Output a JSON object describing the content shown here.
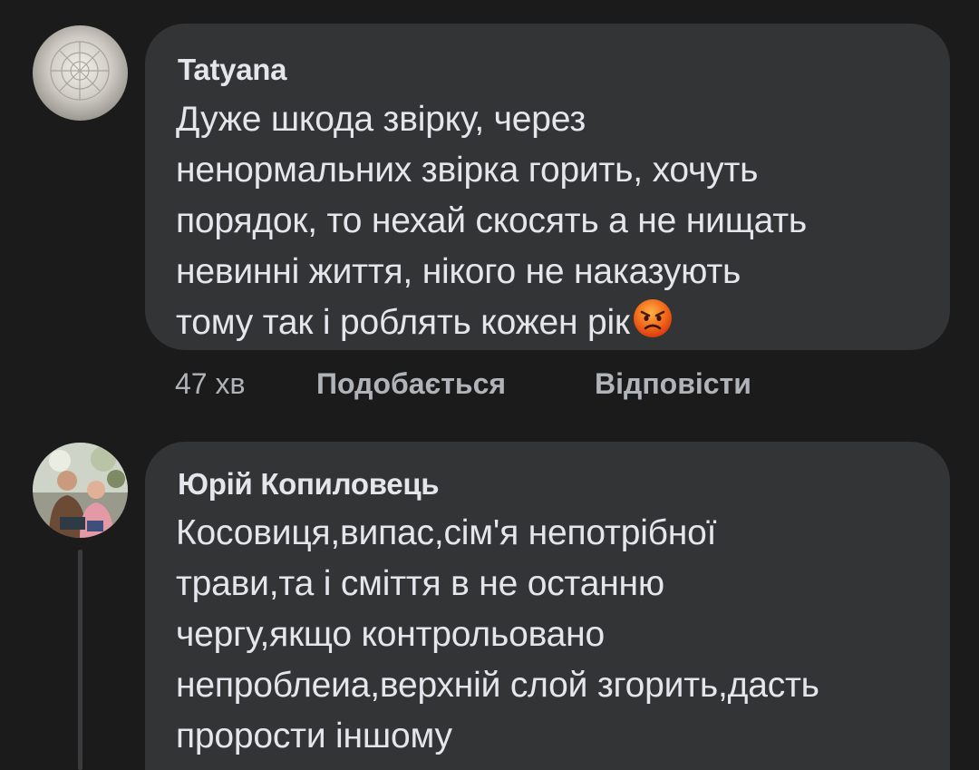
{
  "comments": [
    {
      "author": "Tatyana",
      "text_lines": [
        "Дуже шкода звірку, через",
        "ненормальних звірка горить, хочуть",
        "порядок, то нехай скосять а не нищать",
        "невинні життя, нікого не наказують",
        "тому так і роблять кожен рік"
      ],
      "emoji": "angry-face-emoji",
      "time": "47 хв",
      "like_label": "Подобається",
      "reply_label": "Відповісти"
    },
    {
      "author": "Юрій Копиловець",
      "text_lines": [
        "Косовиця,випас,сім'я непотрібної",
        "трави,та і сміття в не останню",
        "чергу,якщо контрольовано",
        "непроблеиа,верхній слой згорить,дасть",
        "прорости іншому"
      ]
    }
  ],
  "colors": {
    "background": "#1b1b1b",
    "bubble": "#333435",
    "text": "#e4e6eb",
    "meta": "#b0b3b8"
  }
}
